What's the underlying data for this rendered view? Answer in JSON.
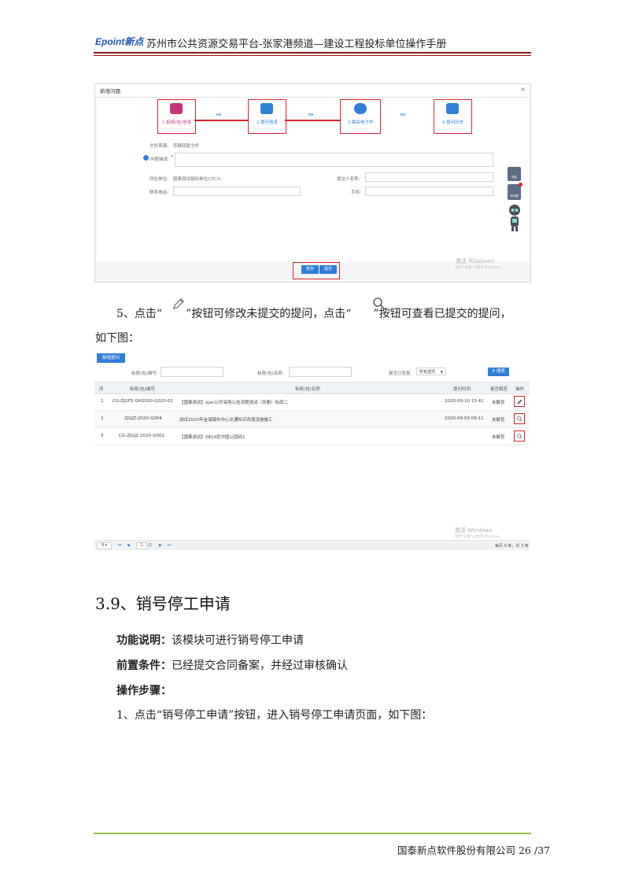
{
  "header": {
    "logo": "Epoint新点",
    "title": "苏州市公共资源交易平台-张家港频道—建设工程投标单位操作手册"
  },
  "dialog": {
    "title": "新增问题",
    "close": "×",
    "steps": [
      {
        "label": "1.标段(包)信息",
        "color": "#c7327b"
      },
      {
        "label": "2.提问信息",
        "color": "#2f7ed8"
      },
      {
        "label": "3.相关电子件",
        "color": "#2f7ed8"
      },
      {
        "label": "4.提问历史",
        "color": "#2f7ed8"
      }
    ],
    "arrows": "›››",
    "fields": {
      "file_source_label": "文件来源:",
      "file_source_value": "答疑回复文件",
      "question_desc_label": "问题描述:",
      "required_mark": "*",
      "unit_label": "所在单位:",
      "unit_value": "国泰测试投标单位CFCA",
      "submitter_label": "提交人名称:",
      "phone_label": "联系电话:",
      "mobile_label": "手机:"
    },
    "side_buttons": [
      "回复",
      "填问题"
    ],
    "watermark": "激活 Windows",
    "watermark_sub": "转到\"设置\"以激活 Windows。",
    "buttons": {
      "save": "暂存",
      "submit": "提交"
    }
  },
  "para5": {
    "prefix": "5、点击“",
    "mid": "”按钮可修改未提交的提问，点击“",
    "suffix": "”按钮可查看已提交的提问，",
    "line2": "如下图："
  },
  "table_view": {
    "new_button": "新增提问",
    "filters": {
      "code_label": "标段(包)编号:",
      "name_label": "标段(包)名称:",
      "answered_label": "是否已答复:",
      "answered_value": "所有选项",
      "search_button": "搜索"
    },
    "columns": [
      "序",
      "标段(包)编号",
      "标段(包)名称",
      "提问时间",
      "是否解答",
      "操作"
    ],
    "rows": [
      {
        "no": "1",
        "code": "CG-ZJGFS-GH2020-G020-02",
        "name": "【国泰测试】xjan公开采购公告流程测试（勿删）标段二",
        "time": "2020-09-10 15:41",
        "status": "未解答",
        "op": "pencil-icon"
      },
      {
        "no": "2",
        "code": "ZJGJZ-2020-G004",
        "name": "测试2020年金港镇市中心交通标识改造设施施工",
        "time": "2020-09-03 09:11",
        "status": "未解答",
        "op": "search-icon"
      },
      {
        "no": "3",
        "code": "CG-ZJGJZ-2020-G002",
        "name": "【国泰测试】0819您中国公园码1",
        "time": "",
        "status": "未解答",
        "op": "search-icon"
      }
    ],
    "watermark": "激活 Windows",
    "watermark_sub": "转到\"设置\"以激活 Windows。",
    "pager": {
      "page_size": "9",
      "page": "1",
      "of": "/1",
      "summary": "每页 9 条，共 3 条"
    }
  },
  "section": {
    "title": "3.9、销号停工申请",
    "func_label": "功能说明：",
    "func_text": "该模块可进行销号停工申请",
    "pre_label": "前置条件：",
    "pre_text": "已经提交合同备案，并经过审核确认",
    "steps_label": "操作步骤：",
    "step1": "1、点击“销号停工申请”按钮，进入销号停工申请页面，如下图："
  },
  "footer": {
    "text": "国泰新点软件股份有限公司 26 /37"
  }
}
